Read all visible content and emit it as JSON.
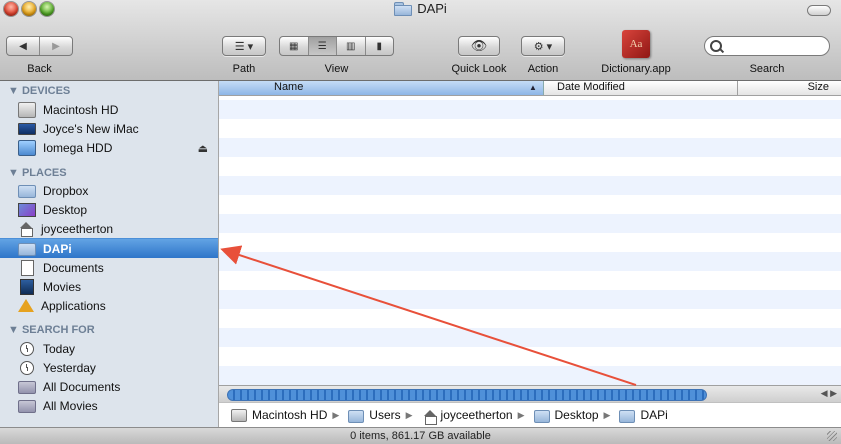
{
  "window": {
    "title": "DAPi"
  },
  "toolbar": {
    "back_label": "Back",
    "path_label": "Path",
    "view_label": "View",
    "quicklook_label": "Quick Look",
    "action_label": "Action",
    "dictionary_label": "Dictionary.app",
    "dictionary_icon_text": "Aa",
    "search_label": "Search",
    "search_value": ""
  },
  "sidebar": {
    "sections": [
      {
        "title": "DEVICES"
      },
      {
        "title": "PLACES"
      },
      {
        "title": "SEARCH FOR"
      }
    ],
    "items": [
      {
        "label": "Macintosh HD",
        "icon": "hard-drive-icon"
      },
      {
        "label": "Joyce's New iMac",
        "icon": "imac-icon"
      },
      {
        "label": "Iomega HDD",
        "icon": "external-drive-icon"
      },
      {
        "label": "Dropbox",
        "icon": "folder-icon"
      },
      {
        "label": "Desktop",
        "icon": "desktop-icon"
      },
      {
        "label": "joyceetherton",
        "icon": "home-icon"
      },
      {
        "label": "DAPi",
        "icon": "folder-icon",
        "selected": true
      },
      {
        "label": "Documents",
        "icon": "documents-icon"
      },
      {
        "label": "Movies",
        "icon": "movies-icon"
      },
      {
        "label": "Applications",
        "icon": "applications-icon"
      },
      {
        "label": "Today",
        "icon": "clock-icon"
      },
      {
        "label": "Yesterday",
        "icon": "clock-icon"
      },
      {
        "label": "All Documents",
        "icon": "smart-folder-icon"
      },
      {
        "label": "All Movies",
        "icon": "smart-folder-icon"
      }
    ]
  },
  "columns": {
    "name": "Name",
    "date": "Date Modified",
    "size": "Size"
  },
  "pathbar": [
    {
      "label": "Macintosh HD"
    },
    {
      "label": "Users"
    },
    {
      "label": "joyceetherton"
    },
    {
      "label": "Desktop"
    },
    {
      "label": "DAPi"
    }
  ],
  "status": {
    "text": "0 items, 861.17 GB available"
  },
  "colors": {
    "selection": "#3b82d6",
    "sidebar_bg": "#dde4ec",
    "annotation_arrow": "#e8503a"
  }
}
